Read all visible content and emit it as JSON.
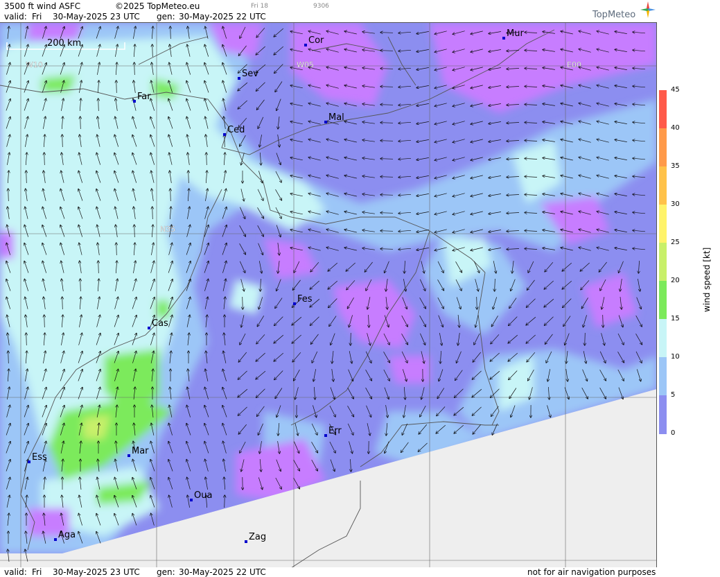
{
  "header": {
    "product": "3500 ft wind ASFC",
    "copyright": "©2025 TopMeteo.eu",
    "day_marker": "Fri 18",
    "code": "9306",
    "valid_label": "valid:",
    "valid_day": "Fri",
    "valid_time": "30-May-2025  23 UTC",
    "gen_label": "gen:",
    "gen_time": "30-May-2025 22 UTC"
  },
  "logo": {
    "text": "TopMeteo",
    "icon": "compass-star-icon"
  },
  "map": {
    "scale_label": "200 km",
    "grid_labels": {
      "w10": "W10",
      "w05": "W05",
      "e00": "E00",
      "n35": "N35"
    },
    "cities": [
      {
        "name": "Cor"
      },
      {
        "name": "Mur"
      },
      {
        "name": "Sev"
      },
      {
        "name": "Far"
      },
      {
        "name": "Ced"
      },
      {
        "name": "Mal"
      },
      {
        "name": "Fes"
      },
      {
        "name": "Cas"
      },
      {
        "name": "Err"
      },
      {
        "name": "Ess"
      },
      {
        "name": "Mar"
      },
      {
        "name": "Oua"
      },
      {
        "name": "Aga"
      },
      {
        "name": "Zag"
      }
    ],
    "no_data_color": "#eeeeee"
  },
  "legend": {
    "title": "wind speed [kt]",
    "ticks": [
      "45",
      "40",
      "35",
      "30",
      "25",
      "20",
      "15",
      "10",
      "5",
      "0"
    ],
    "colors": {
      "c0": "#c77dff",
      "c5": "#8c8ef0",
      "c10": "#9cc6f7",
      "c15": "#c8f5f7",
      "c20": "#7bea5b",
      "c25": "#c8f06a",
      "c30": "#fff36a",
      "c35": "#ffc24a",
      "c40": "#ff9a4a",
      "c45": "#ff5a4a"
    }
  },
  "footer": {
    "valid_label": "valid:",
    "valid_day": "Fri",
    "valid_time": "30-May-2025  23 UTC",
    "gen_label": "gen:",
    "gen_time": "30-May-2025 22 UTC",
    "disclaimer": "not for air navigation purposes"
  }
}
